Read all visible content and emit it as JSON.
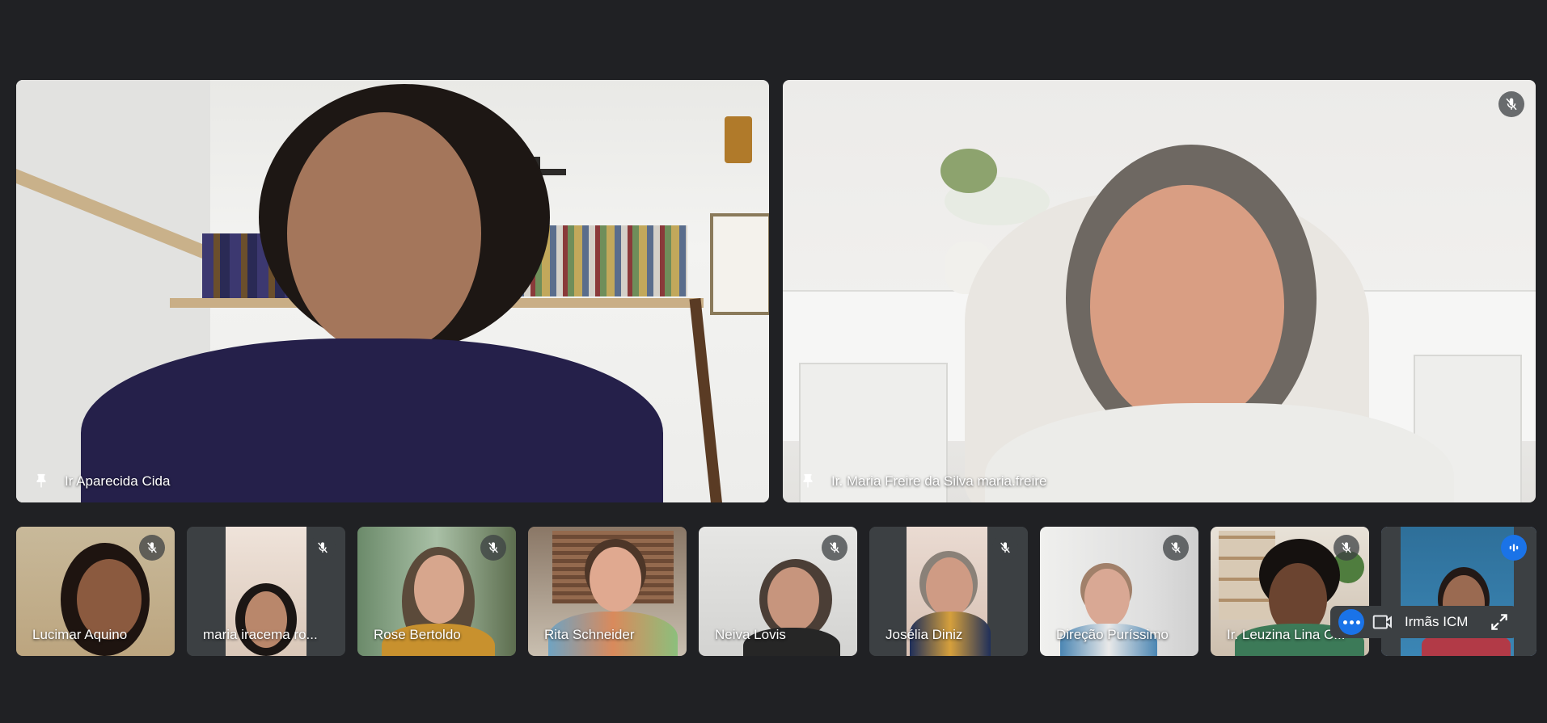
{
  "main_tiles": [
    {
      "name": "Ir Aparecida Cida",
      "pinned": true
    },
    {
      "name": "Ir. Maria Freire da Silva maria.freire",
      "pinned": true,
      "muted": true
    }
  ],
  "thumb_tiles": [
    {
      "name": "Lucimar Aquino",
      "muted": true
    },
    {
      "name": "maria iracema ro...",
      "muted": true
    },
    {
      "name": "Rose Bertoldo",
      "muted": true
    },
    {
      "name": "Rita Schneider",
      "muted": false
    },
    {
      "name": "Neiva Lovis",
      "muted": true
    },
    {
      "name": "Josélia Diniz",
      "muted": true
    },
    {
      "name": "Direção Puríssimo",
      "muted": true
    },
    {
      "name": "Ir. Leuzina Lina C...",
      "muted": true
    },
    {
      "name": "",
      "speaking": true
    }
  ],
  "overlay": {
    "label": "Irmãs ICM"
  },
  "colors": {
    "background": "#202124",
    "accent": "#1a73e8",
    "tile": "#3c4043"
  }
}
